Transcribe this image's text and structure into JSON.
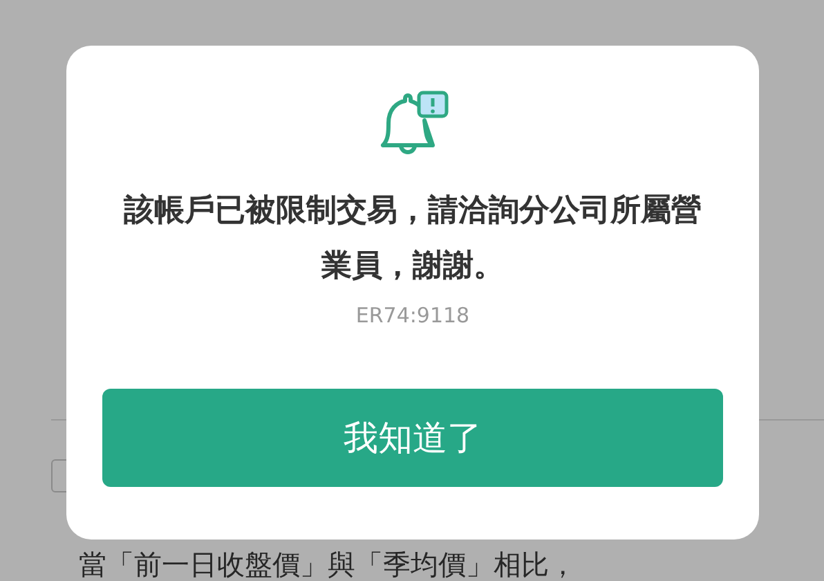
{
  "background": {
    "text": "當「前一日收盤價」與「季均價」相比，"
  },
  "dialog": {
    "message": "該帳戶已被限制交易，請洽詢分公司所屬營業員，謝謝。",
    "code": "ER74:9118",
    "button": "我知道了"
  }
}
